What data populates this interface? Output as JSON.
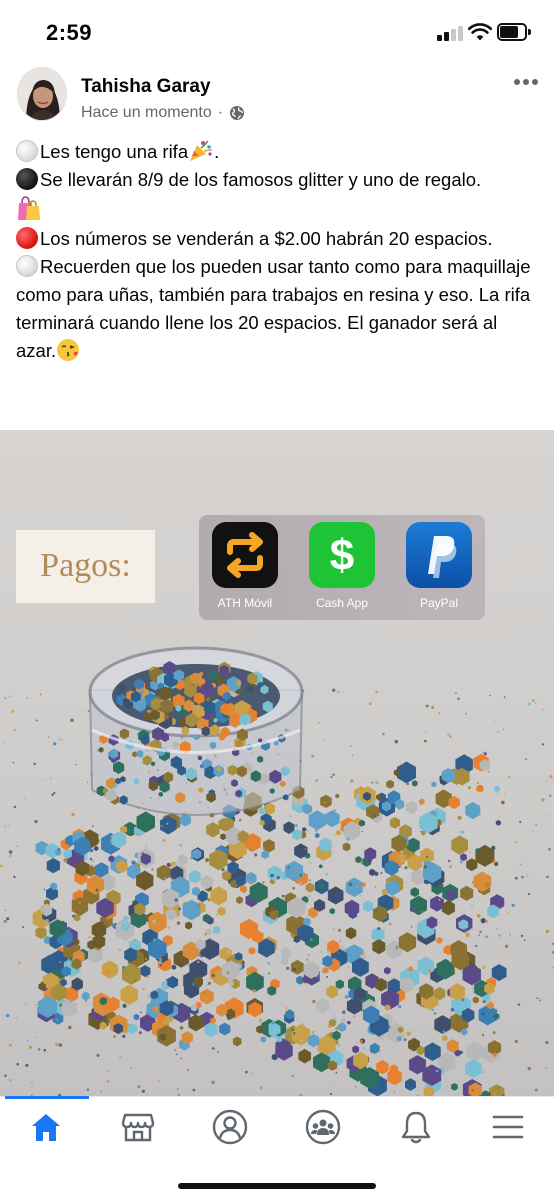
{
  "status_bar": {
    "time": "2:59"
  },
  "post": {
    "author": "Tahisha Garay",
    "timestamp": "Hace un momento",
    "separator": "·",
    "privacy_icon": "globe-icon",
    "lines": [
      "Les tengo una rifa",
      "Se llevarán 8/9 de los famosos glitter y uno de regalo.",
      "Los números se venderán a $2.00 habrán 20 espacios.",
      "Recuerden que los pueden usar tanto como para maquillaje como para uñas, también para trabajos en resina y eso. La rifa terminará cuando llene los 20 espacios. El ganador será al azar."
    ]
  },
  "image": {
    "pagos_label": "Pagos:",
    "apps": [
      {
        "name": "ATH Móvil",
        "icon": "ath-movil-icon"
      },
      {
        "name": "Cash App",
        "icon": "cash-app-icon"
      },
      {
        "name": "PayPal",
        "icon": "paypal-icon"
      }
    ]
  },
  "bottom_nav": {
    "items": [
      "home-icon",
      "marketplace-icon",
      "profile-icon",
      "groups-icon",
      "notifications-icon",
      "menu-icon"
    ],
    "active": "home-icon"
  },
  "colors": {
    "accent": "#1877f2",
    "text": "#050505",
    "secondary_text": "#65676b"
  }
}
